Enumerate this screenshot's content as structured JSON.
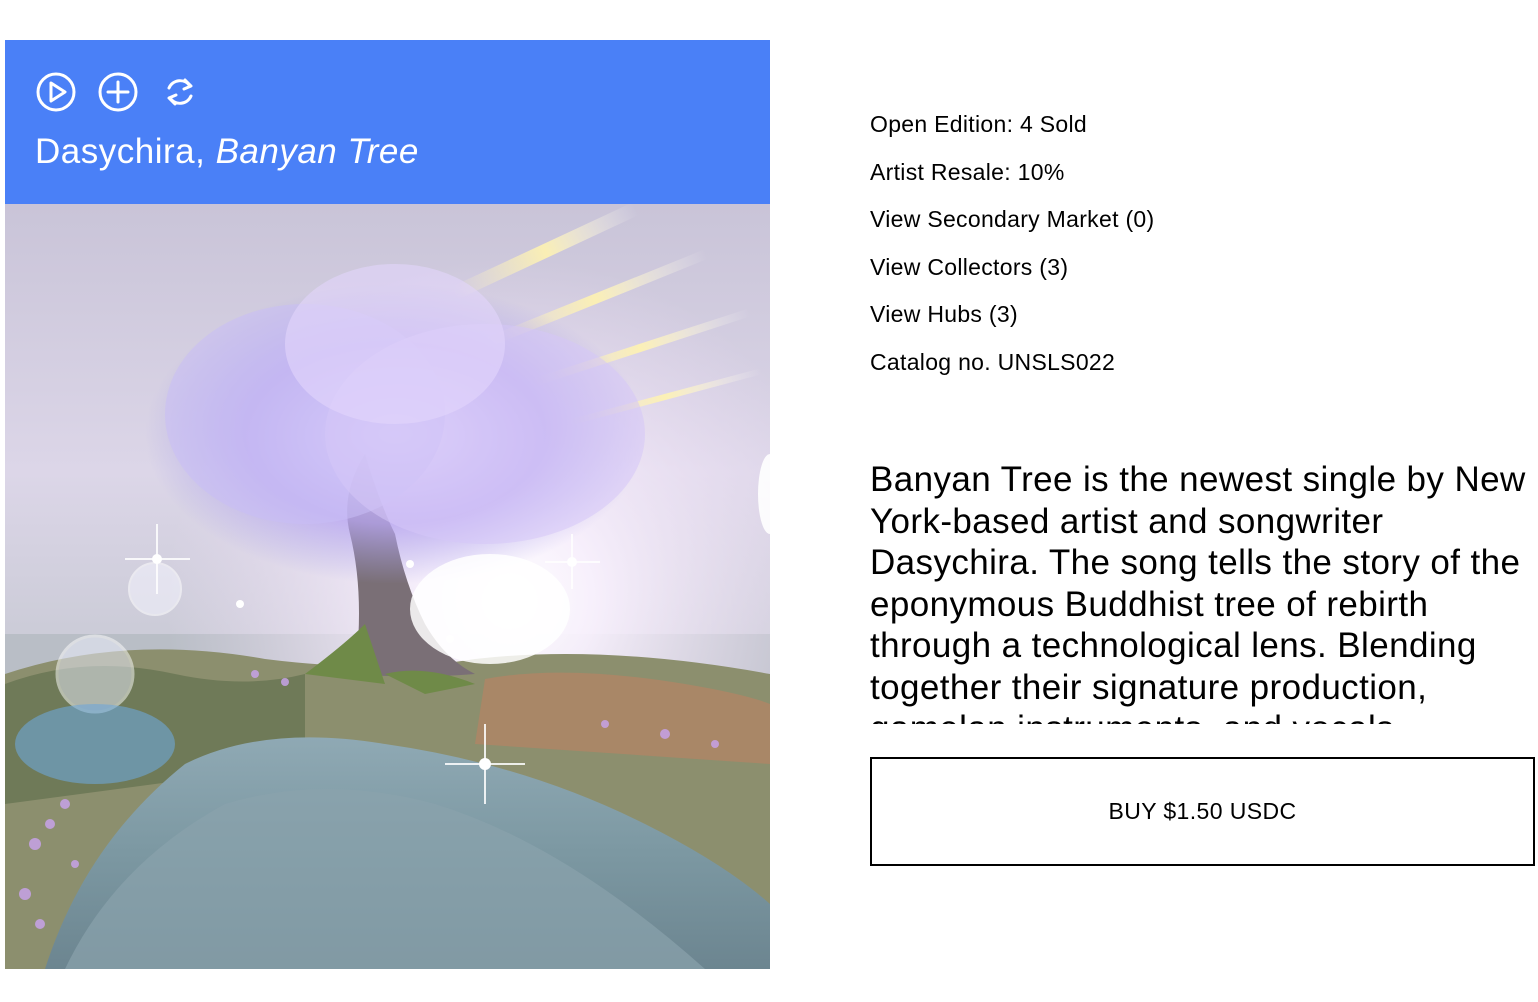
{
  "player": {
    "artist": "Dasychira",
    "separator": ", ",
    "song": "Banyan Tree",
    "controls": [
      {
        "name": "play",
        "icon": "play-circle-icon"
      },
      {
        "name": "add",
        "icon": "plus-circle-icon"
      },
      {
        "name": "repeat",
        "icon": "refresh-icon"
      }
    ],
    "header_color": "#4a80f7"
  },
  "details": {
    "edition": "Open Edition: 4 Sold",
    "resale": "Artist Resale: 10%",
    "secondary_market": "View Secondary Market (0)",
    "collectors": "View Collectors (3)",
    "hubs": "View Hubs (3)",
    "catalog": "Catalog no. UNSLS022"
  },
  "description": "Banyan Tree is the newest single by New York-based artist and songwriter Dasychira. The song tells the story of the eponymous Buddhist tree of rebirth through a technological lens. Blending together their signature production, gamelan instruments, and vocals",
  "buy": {
    "label": "BUY $1.50 USDC"
  }
}
